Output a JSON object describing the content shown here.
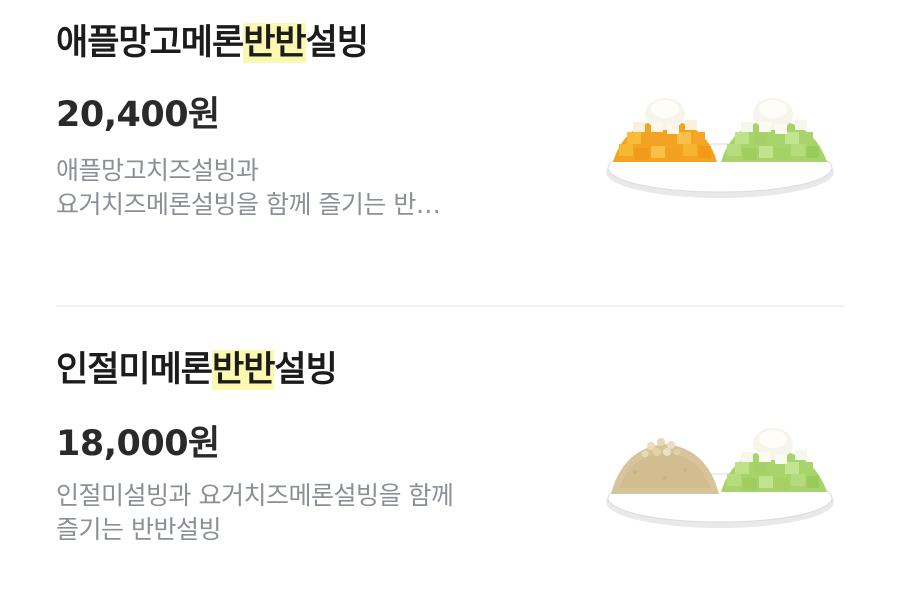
{
  "menu_items": [
    {
      "title_before": "애플망고메론",
      "title_highlight": "반반",
      "title_after": "설빙",
      "price": "20,400원",
      "description_lines": [
        "애플망고치즈설빙과",
        "요거치즈메론설빙을 함께 즐기는 반…"
      ],
      "image_left": "mango-bingsu",
      "image_right": "melon-bingsu"
    },
    {
      "title_before": "인절미메론",
      "title_highlight": "반반",
      "title_after": "설빙",
      "price": "18,000원",
      "description_lines": [
        "인절미설빙과 요거치즈메론설빙을 함께",
        "즐기는 반반설빙"
      ],
      "image_left": "injeolmi-bingsu",
      "image_right": "melon-bingsu"
    }
  ],
  "colors": {
    "highlight": "#fbf8b0",
    "title": "#1c1c1c",
    "description": "#8b8f96",
    "divider": "#f0f0f0"
  }
}
